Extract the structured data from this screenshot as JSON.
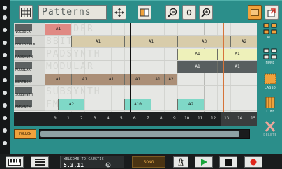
{
  "app": {
    "title": "Patterns",
    "version": "5.3.11",
    "welcome": "WELCOME TO CAUSTIC"
  },
  "toolbar": {
    "grid_icon": "grid-icon",
    "move_icon": "move-arrows-icon",
    "clip_icon": "clip-icon",
    "zoom_out_icon": "zoom-out-icon",
    "zoom_reset_icon": "zoom-reset-icon",
    "zoom_in_icon": "zoom-in-icon",
    "menu_icon": "orange-panel-icon",
    "export_icon": "export-icon"
  },
  "side_tools": [
    {
      "label": "ALL",
      "icon": "select-all-icon"
    },
    {
      "label": "NONE",
      "icon": "select-none-icon"
    },
    {
      "label": "LASSO",
      "icon": "lasso-icon"
    },
    {
      "label": "TIME",
      "icon": "time-icon"
    },
    {
      "label": "DELETE",
      "icon": "delete-icon"
    }
  ],
  "tracks": [
    {
      "name": "VOCODER",
      "ghost": "VOCODER"
    },
    {
      "name": "8BITSYNTH",
      "ghost": "8BIT"
    },
    {
      "name": "PADSYNTH",
      "ghost": "PADSYNTH"
    },
    {
      "name": "MODULAR",
      "ghost": "MODULAR"
    },
    {
      "name": "BEATBOX",
      "ghost": "BEAT"
    },
    {
      "name": "SUBSYNTH",
      "ghost": "SUBSYNTH"
    },
    {
      "name": "FMSYNTH",
      "ghost": "FMS"
    }
  ],
  "patterns": [
    {
      "track": 0,
      "start": 0,
      "len": 2,
      "label": "A1",
      "color": "#e08a84"
    },
    {
      "track": 1,
      "start": 2,
      "len": 4,
      "label": "A1",
      "color": "#d8ccaa"
    },
    {
      "track": 1,
      "start": 6,
      "len": 4,
      "label": "A1",
      "color": "#d8ccaa"
    },
    {
      "track": 1,
      "start": 10,
      "len": 4,
      "label": "A3",
      "color": "#d8ccaa"
    },
    {
      "track": 1,
      "start": 14,
      "len": 2,
      "label": "A2",
      "color": "#d8ccaa"
    },
    {
      "track": 2,
      "start": 10,
      "len": 3,
      "label": "A1",
      "color": "#eef1ba"
    },
    {
      "track": 2,
      "start": 13,
      "len": 3,
      "label": "A1",
      "color": "#eef1ba"
    },
    {
      "track": 3,
      "start": 10,
      "len": 3,
      "label": "A1",
      "color": "#585e5f"
    },
    {
      "track": 3,
      "start": 13,
      "len": 3,
      "label": "A1",
      "color": "#585e5f"
    },
    {
      "track": 4,
      "start": 0,
      "len": 2,
      "label": "A1",
      "color": "#ab8f77"
    },
    {
      "track": 4,
      "start": 2,
      "len": 2,
      "label": "A1",
      "color": "#ab8f77"
    },
    {
      "track": 4,
      "start": 4,
      "len": 2,
      "label": "A1",
      "color": "#ab8f77"
    },
    {
      "track": 4,
      "start": 6,
      "len": 2,
      "label": "A1",
      "color": "#ab8f77"
    },
    {
      "track": 4,
      "start": 8,
      "len": 1,
      "label": "A1",
      "color": "#ab8f77"
    },
    {
      "track": 4,
      "start": 9,
      "len": 1,
      "label": "A2",
      "color": "#ab8f77"
    },
    {
      "track": 6,
      "start": 1,
      "len": 2,
      "label": "A2",
      "color": "#7fd8c7"
    },
    {
      "track": 6,
      "start": 6,
      "len": 2,
      "label": "A10",
      "color": "#7fd8c7"
    },
    {
      "track": 6,
      "start": 10,
      "len": 2,
      "label": "A2",
      "color": "#7fd8c7"
    }
  ],
  "ruler": [
    "0",
    "1",
    "2",
    "3",
    "4",
    "5",
    "6",
    "7",
    "8",
    "9",
    "10",
    "11",
    "12",
    "13",
    "14",
    "15"
  ],
  "follow_label": "FOLLOW",
  "song_label": "SONG",
  "scroll_position": 0.95,
  "colors": {
    "accent": "#2b8e8a",
    "orange": "#f0a23c",
    "record": "#e0261c",
    "play": "#19a53a"
  }
}
